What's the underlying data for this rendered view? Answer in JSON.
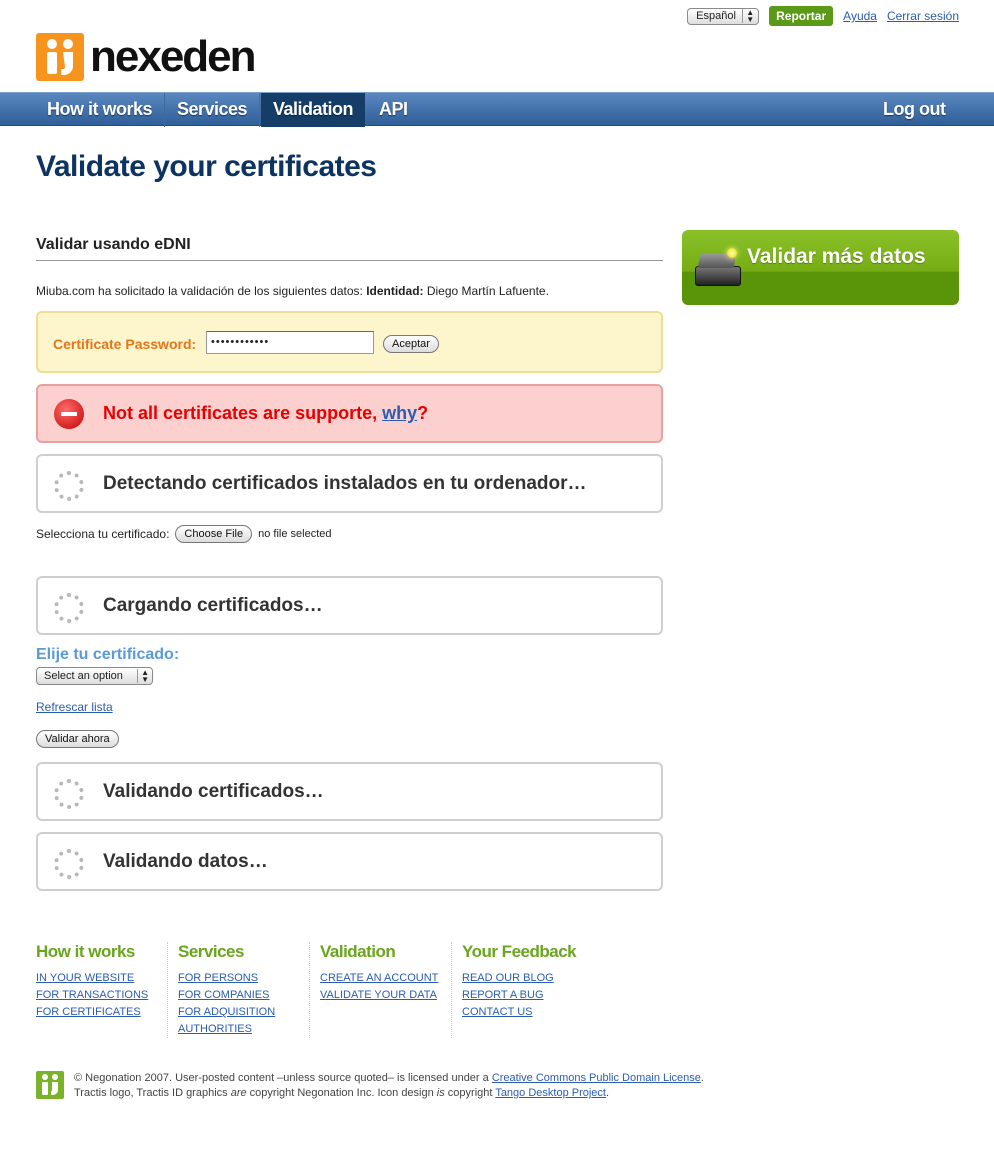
{
  "topbar": {
    "language": "Español",
    "report_label": "Reportar",
    "help_label": "Ayuda",
    "logout_label": "Cerrar sesión"
  },
  "logo": {
    "text": "nexeden"
  },
  "nav": {
    "items": [
      {
        "label": "How it works"
      },
      {
        "label": "Services"
      },
      {
        "label": "Validation"
      },
      {
        "label": "API"
      }
    ],
    "logout": "Log out"
  },
  "page": {
    "title": "Validate your certificates"
  },
  "main": {
    "section_title": "Validar usando eDNI",
    "request_prefix": "Miuba.com ha solicitado la validación de los siguientes datos: ",
    "request_label": "Identidad:",
    "request_value": " Diego Martín Lafuente.",
    "password_label": "Certificate Password:",
    "password_value": "••••••••••••",
    "accept_label": "Aceptar",
    "error_text": "Not all certificates are supporte, ",
    "error_link": "why",
    "error_suffix": "?",
    "status_detecting": "Detectando certificados instalados en tu ordenador…",
    "file_label": "Selecciona tu certificado:",
    "file_button": "Choose File",
    "file_none": "no file selected",
    "status_loading": "Cargando certificados…",
    "choose_label": "Elije tu certificado:",
    "select_value": "Select an option",
    "refresh_label": "Refrescar lista",
    "validate_now": "Validar ahora",
    "status_validating_certs": "Validando certificados…",
    "status_validating_data": "Validando datos…"
  },
  "promo": {
    "label": "Validar más datos"
  },
  "footer": {
    "columns": [
      {
        "title": "How it works",
        "links": [
          "IN YOUR WEBSITE",
          "FOR TRANSACTIONS",
          "FOR CERTIFICATES"
        ]
      },
      {
        "title": "Services",
        "links": [
          "FOR PERSONS",
          "FOR COMPANIES",
          "FOR ADQUISITION",
          "AUTHORITIES"
        ]
      },
      {
        "title": "Validation",
        "links": [
          "CREATE AN ACCOUNT",
          "VALIDATE YOUR DATA"
        ]
      },
      {
        "title": "Your Feedback",
        "links": [
          "READ OUR BLOG",
          "REPORT A BUG",
          "CONTACT US"
        ]
      }
    ],
    "legal_line1_prefix": "© Negonation 2007. User-posted content –unless source quoted– is licensed under a ",
    "legal_link1": "Creative Commons Public Domain License",
    "legal_line1_suffix": ".",
    "legal_line2_a": "Tractis logo, Tractis ID graphics ",
    "legal_are": "are",
    "legal_line2_b": " copyright Negonation Inc. Icon design ",
    "legal_is": "is",
    "legal_line2_c": " copyright ",
    "legal_link2": "Tango Desktop Project",
    "legal_line2_suffix": "."
  },
  "colors": {
    "nav_blue": "#2f5f99",
    "title_blue": "#0d3460",
    "accent_green": "#6aa51e",
    "error_red": "#e60000",
    "warning_orange": "#e4761b"
  }
}
